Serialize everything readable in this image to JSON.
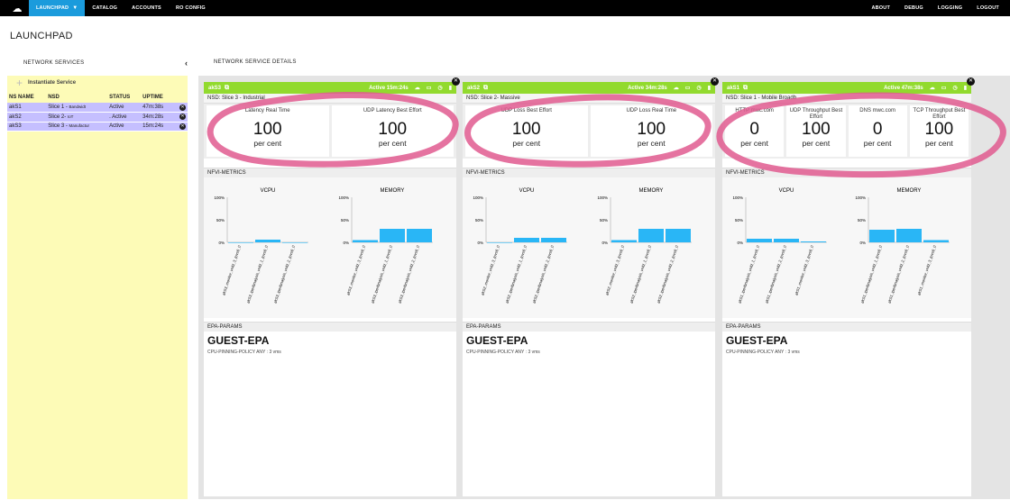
{
  "nav": {
    "items": [
      "LAUNCHPAD",
      "CATALOG",
      "ACCOUNTS",
      "RO CONFIG"
    ],
    "right_items": [
      "ABOUT",
      "DEBUG",
      "LOGGING",
      "LOGOUT"
    ],
    "logo_icon": "cloud-logo-icon"
  },
  "page": {
    "title": "LAUNCHPAD",
    "left_panel_title": "NETWORK SERVICES",
    "detail_title": "NETWORK SERVICE DETAILS",
    "instantiate_label": "Instantiate Service"
  },
  "ns_table": {
    "headers": [
      "NS NAME",
      "NSD",
      "STATUS",
      "UPTIME"
    ],
    "rows": [
      {
        "name": "akS1",
        "nsd_main": "Slice 1 - ",
        "nsd_sub": "Bandwidt",
        "status": "Active",
        "uptime": "47m:38s"
      },
      {
        "name": "akS2",
        "nsd_main": "Slice 2- ",
        "nsd_sub": "IoT",
        "status": ". Active",
        "uptime": "34m:28s"
      },
      {
        "name": "akS3",
        "nsd_main": "Slice 3 - ",
        "nsd_sub": "Manufactur",
        "status": "Active",
        "uptime": "15m:24s"
      }
    ]
  },
  "cards": [
    {
      "name": "akS3",
      "active": "Active 15m:24s",
      "nsd": "NSD: Slice 3 - Industrial",
      "kpis": [
        {
          "name": "Latency Real Time",
          "value": "100",
          "unit": "per cent"
        },
        {
          "name": "UDP Latency Best Effort",
          "value": "100",
          "unit": "per cent"
        }
      ],
      "metrics_title": "NFVI-METRICS",
      "vcpu": {
        "title": "VCPU",
        "ticks": [
          "100%",
          "50%",
          "0%"
        ],
        "labels": [
          "akS3_monitor_vnfd_3_(ovs6_0",
          "akS3_iperfanalysis_vnfd_1_(ovs6_0",
          "akS3_iperfanalysis_vnfd_2_(ovs6_0"
        ],
        "values": [
          0,
          6,
          0
        ]
      },
      "memory": {
        "title": "MEMORY",
        "ticks": [
          "100%",
          "50%",
          "0%"
        ],
        "labels": [
          "akS3_monitor_vnfd_3_(ovs6_0",
          "akS3_iperfanalysis_vnfd_1_(ovs6_0",
          "akS3_iperfanalysis_vnfd_2_(ovs6_0"
        ],
        "values": [
          5,
          30,
          30
        ]
      },
      "epa_title": "EPA-PARAMS",
      "epa_name": "GUEST-EPA",
      "epa_line": "CPU-PINNING-POLICY   ANY : 3 vms"
    },
    {
      "name": "akS2",
      "active": "Active 34m:28s",
      "nsd": "NSD: Slice 2- Massive",
      "kpis": [
        {
          "name": "UDP Loss Best Effort",
          "value": "100",
          "unit": "per cent"
        },
        {
          "name": "UDP Loss Real Time",
          "value": "100",
          "unit": "per cent"
        }
      ],
      "metrics_title": "NFVI-METRICS",
      "vcpu": {
        "title": "VCPU",
        "ticks": [
          "100%",
          "50%",
          "0%"
        ],
        "labels": [
          "akS2_monitor_vnfd_3_(ovs6_0",
          "akS2_iperfanalysis_vnfd_1_(ovs6_0",
          "akS2_iperfanalysis_vnfd_2_(ovs6_0"
        ],
        "values": [
          0,
          10,
          10
        ]
      },
      "memory": {
        "title": "MEMORY",
        "ticks": [
          "100%",
          "50%",
          "0%"
        ],
        "labels": [
          "akS2_monitor_vnfd_3_(ovs6_0",
          "akS2_iperfanalysis_vnfd_1_(ovs6_0",
          "akS2_iperfanalysis_vnfd_2_(ovs6_0"
        ],
        "values": [
          5,
          30,
          30
        ]
      },
      "epa_title": "EPA-PARAMS",
      "epa_name": "GUEST-EPA",
      "epa_line": "CPU-PINNING-POLICY   ANY : 3 vms"
    },
    {
      "name": "akS1",
      "active": "Active 47m:38s",
      "nsd": "NSD: Slice 1 - Mobile Broadb",
      "kpis": [
        {
          "name": "HTTP mwc.com",
          "value": "0",
          "unit": "per cent"
        },
        {
          "name": "UDP Throughput Best Effort",
          "value": "100",
          "unit": "per cent"
        },
        {
          "name": "DNS mwc.com",
          "value": "0",
          "unit": "per cent"
        },
        {
          "name": "TCP Throughput Best Effort",
          "value": "100",
          "unit": "per cent"
        }
      ],
      "metrics_title": "NFVI-METRICS",
      "vcpu": {
        "title": "VCPU",
        "ticks": [
          "100%",
          "50%",
          "0%"
        ],
        "labels": [
          "akS1_iperfanalysis_vnfd_1_(ovs6_0",
          "akS1_iperfanalysis_vnfd_2_(ovs6_0",
          "akS1_monitor_vnfd_3_(ovs6_0"
        ],
        "values": [
          8,
          8,
          2
        ]
      },
      "memory": {
        "title": "MEMORY",
        "ticks": [
          "100%",
          "50%",
          "0%"
        ],
        "labels": [
          "akS1_iperfanalysis_vnfd_1_(ovs6_0",
          "akS1_iperfanalysis_vnfd_2_(ovs6_0",
          "akS1_monitor_vnfd_3_(ovs6_0"
        ],
        "values": [
          28,
          30,
          5
        ]
      },
      "epa_title": "EPA-PARAMS",
      "epa_name": "GUEST-EPA",
      "epa_line": "CPU-PINNING-POLICY   ANY : 3 vms"
    }
  ],
  "colors": {
    "nav_active": "#1b9bdc",
    "card_header": "#92da2e",
    "bar": "#29b6f6",
    "row_highlight": "#c5bfff",
    "left_panel": "#fdfbb7",
    "annotation": "#e05a8f"
  }
}
